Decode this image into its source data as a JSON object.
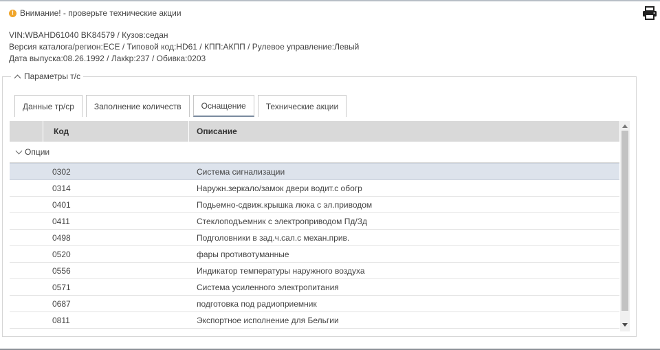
{
  "warning": {
    "icon": "exclamation-icon",
    "text": "Внимание! - проверьте технические акции"
  },
  "toolbar": {
    "print_icon": "printer-icon"
  },
  "vehicle_info": {
    "line1": "VIN:WBAHD61040 BK84579 / Кузов:седан",
    "line2": "Версия каталога/регион:ECE / Типовой код:HD61 / КПП:АКПП / Рулевое управление:Левый",
    "line3": "Дата выпуска:08.26.1992 / Лакkр:237 / Обивка:0203"
  },
  "params_section": {
    "legend": "Параметры т/с"
  },
  "tabs": [
    {
      "label": "Данные тр/ср"
    },
    {
      "label": "Заполнение количеств"
    },
    {
      "label": "Оснащение"
    },
    {
      "label": "Технические акции"
    }
  ],
  "active_tab": "Оснащение",
  "grid": {
    "columns": {
      "code": "Код",
      "description": "Описание"
    },
    "group_label": "Опции",
    "rows": [
      {
        "code": "0302",
        "description": "Система сигнализации"
      },
      {
        "code": "0314",
        "description": "Наружн.зеркало/замок двери водит.с обогр"
      },
      {
        "code": "0401",
        "description": "Подьемно-сдвиж.крышка люка с эл.приводом"
      },
      {
        "code": "0411",
        "description": "Стеклоподъемник с электроприводом Пд/Зд"
      },
      {
        "code": "0498",
        "description": "Подголовники в зад.ч.сал.с механ.прив."
      },
      {
        "code": "0520",
        "description": "фары противотуманные"
      },
      {
        "code": "0556",
        "description": "Индикатор температуры наружного воздуха"
      },
      {
        "code": "0571",
        "description": "Система усиленного электропитания"
      },
      {
        "code": "0687",
        "description": "подготовка под радиоприемник"
      },
      {
        "code": "0811",
        "description": "Экспортное исполнение для Бельгии"
      }
    ],
    "selected_code": "0302"
  },
  "colors": {
    "warning": "#f0a52a",
    "header_bg": "#d9d9d9",
    "selected_row": "#dde3ec"
  }
}
